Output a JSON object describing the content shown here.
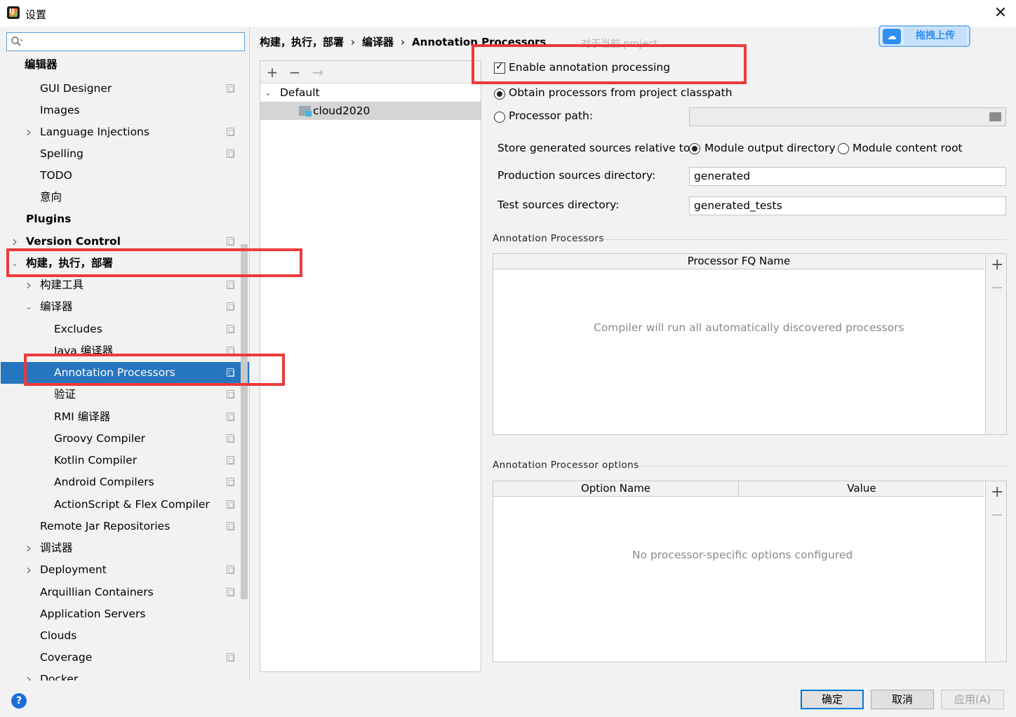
{
  "window": {
    "title": "设置",
    "close_glyph": "✕"
  },
  "search": {
    "placeholder": ""
  },
  "sidebar": {
    "items": [
      {
        "label": "编辑器",
        "bold": true
      },
      {
        "label": "GUI Designer"
      },
      {
        "label": "Images"
      },
      {
        "label": "Language Injections"
      },
      {
        "label": "Spelling"
      },
      {
        "label": "TODO"
      },
      {
        "label": "意向"
      },
      {
        "label": "Plugins",
        "bold": true
      },
      {
        "label": "Version Control",
        "bold": true
      },
      {
        "label": "构建，执行，部署",
        "bold": true
      },
      {
        "label": "构建工具"
      },
      {
        "label": "编译器"
      },
      {
        "label": "Excludes"
      },
      {
        "label": "Java 编译器"
      },
      {
        "label": "Annotation Processors",
        "selected": true
      },
      {
        "label": "验证"
      },
      {
        "label": "RMI 编译器"
      },
      {
        "label": "Groovy Compiler"
      },
      {
        "label": "Kotlin Compiler"
      },
      {
        "label": "Android Compilers"
      },
      {
        "label": "ActionScript & Flex Compiler"
      },
      {
        "label": "Remote Jar Repositories"
      },
      {
        "label": "调试器"
      },
      {
        "label": "Deployment"
      },
      {
        "label": "Arquillian Containers"
      },
      {
        "label": "Application Servers"
      },
      {
        "label": "Clouds"
      },
      {
        "label": "Coverage"
      },
      {
        "label": "Docker"
      }
    ]
  },
  "breadcrumb": {
    "items": [
      "构建，执行，部署",
      "编译器",
      "Annotation Processors"
    ],
    "separator": "›",
    "note": "对于当前 project"
  },
  "upload_widget": {
    "label": "拖拽上传"
  },
  "profiles": {
    "toolbar": {
      "add": "+",
      "remove": "−",
      "move": "→"
    },
    "default_label": "Default",
    "module_label": "cloud2020"
  },
  "settings": {
    "enable_label": "Enable annotation processing",
    "enable_checked": true,
    "obtain_label": "Obtain processors from project classpath",
    "processor_path_label": "Processor path:",
    "processor_path_value": "",
    "store_label": "Store generated sources relative to:",
    "module_output_label": "Module output directory",
    "module_content_label": "Module content root",
    "production_label": "Production sources directory:",
    "production_value": "generated",
    "test_label": "Test sources directory:",
    "test_value": "generated_tests"
  },
  "processors_section": {
    "title": "Annotation Processors",
    "column": "Processor FQ Name",
    "empty_text": "Compiler will run all automatically discovered processors"
  },
  "options_section": {
    "title": "Annotation Processor options",
    "columns": [
      "Option Name",
      "Value"
    ],
    "empty_text": "No processor-specific options configured"
  },
  "buttons": {
    "ok": "确定",
    "cancel": "取消",
    "apply": "应用(A)",
    "help": "?"
  },
  "colors": {
    "selection": "#2675bf",
    "highlight_box": "#ec3a3a",
    "accent": "#0078d7"
  }
}
